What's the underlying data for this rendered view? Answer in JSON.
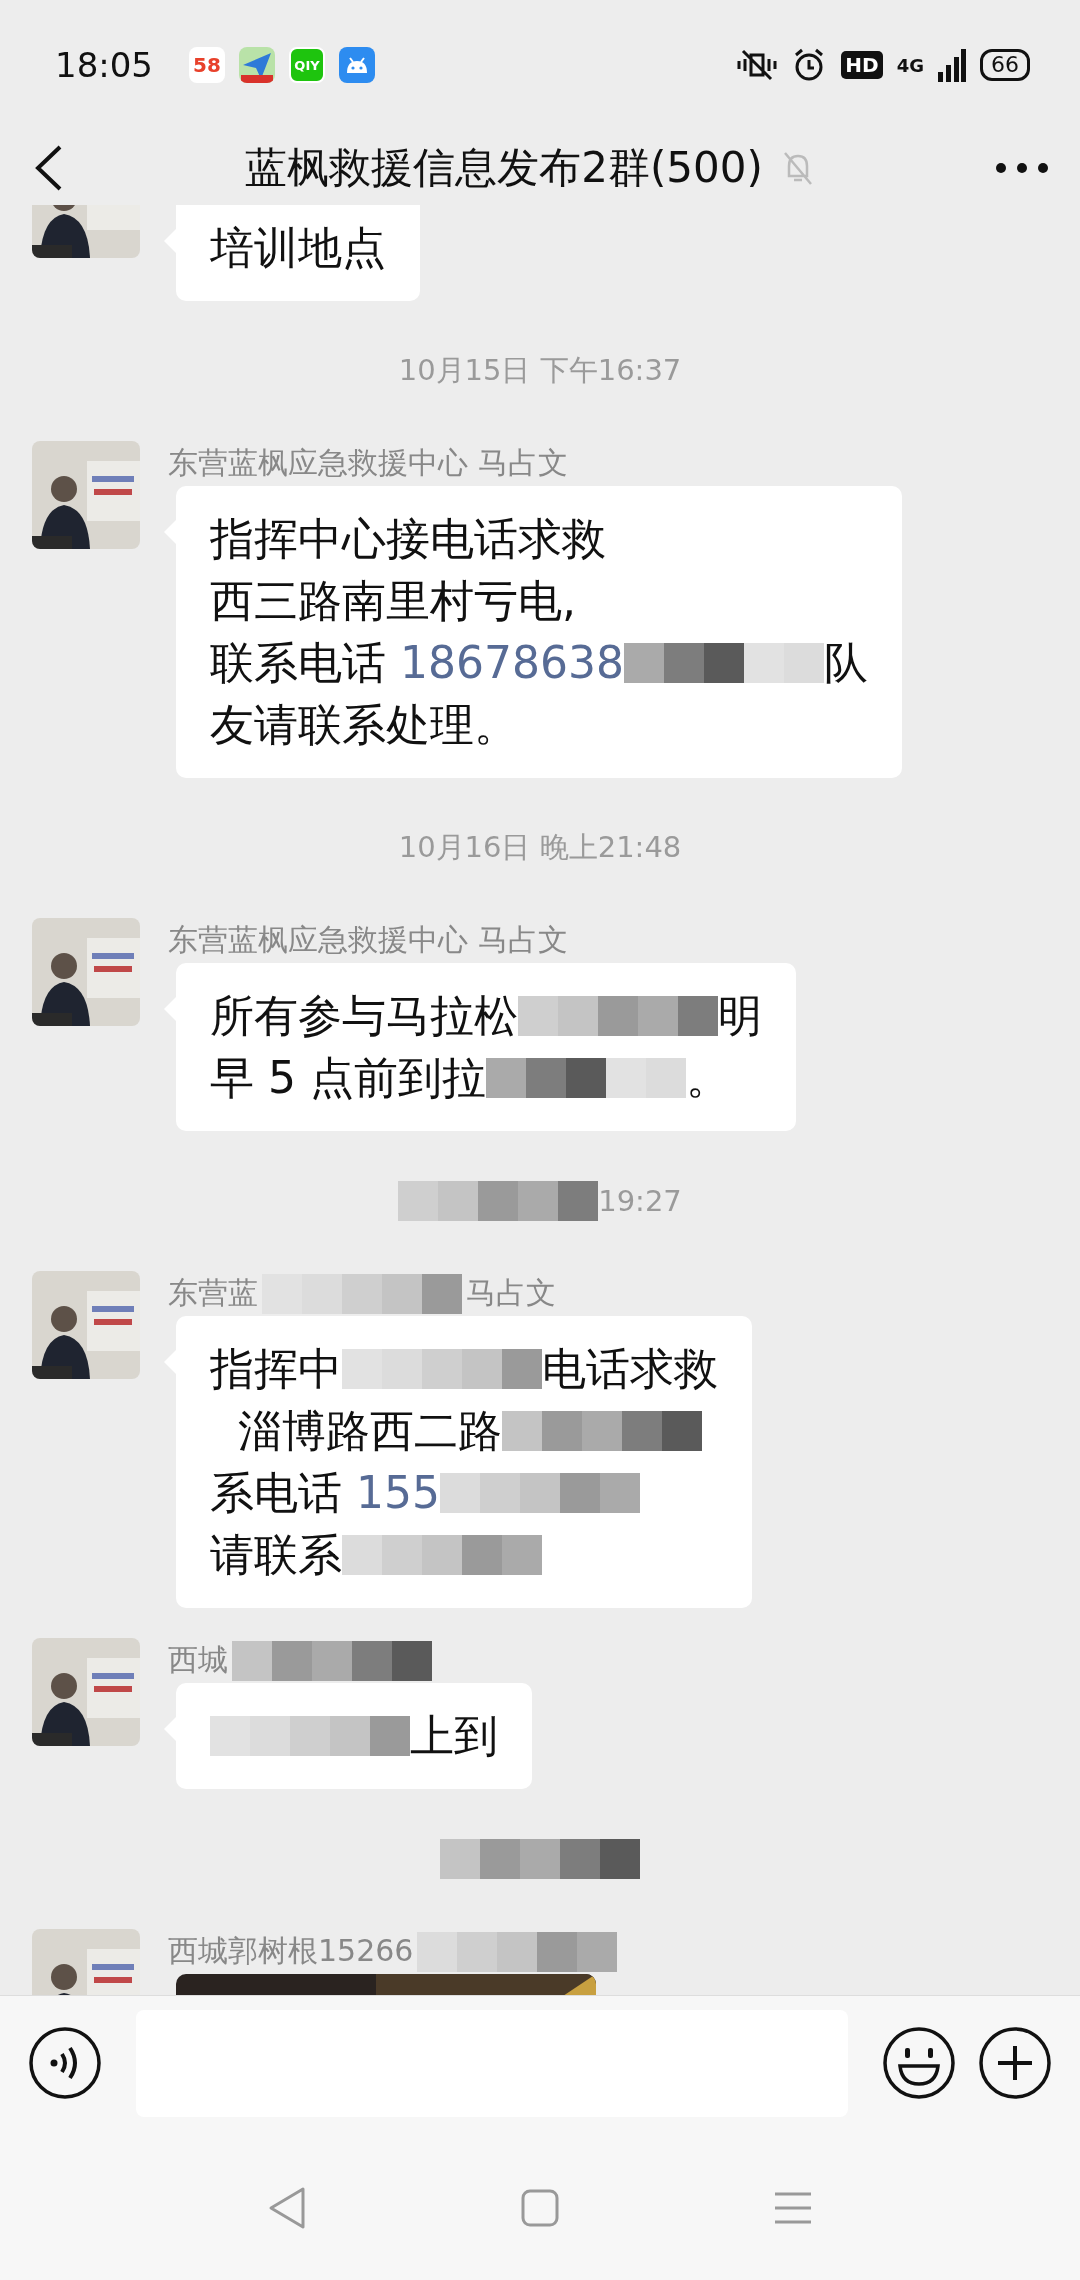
{
  "status_bar": {
    "time": "18:05",
    "app_icons": [
      {
        "kind": "number",
        "text": "58"
      },
      {
        "kind": "plane"
      },
      {
        "kind": "video",
        "text": "QIY"
      },
      {
        "kind": "android"
      }
    ],
    "hd": "HD",
    "network": "4G",
    "battery": "66"
  },
  "header": {
    "title": "蓝枫救援信息发布2群(500)",
    "muted": true
  },
  "messages": [
    {
      "kind": "message",
      "avatar": {
        "kind": "picture"
      },
      "lines": [
        [
          {
            "kind": "text",
            "text": "培训地点"
          }
        ]
      ]
    },
    {
      "kind": "time",
      "parts": [
        {
          "kind": "text",
          "text": "10月15日 下午16:37"
        }
      ]
    },
    {
      "kind": "message",
      "avatar": {
        "kind": "picture"
      },
      "name": [
        {
          "kind": "text",
          "text": "东营蓝枫应急救援中心 马占文"
        }
      ],
      "lines": [
        [
          {
            "kind": "text",
            "text": "指挥中心接电话求救"
          }
        ],
        [
          {
            "kind": "text",
            "text": "西三路南里村亏电,"
          }
        ],
        [
          {
            "kind": "text",
            "text": "联系电话 "
          },
          {
            "kind": "phone",
            "text": "18678638"
          },
          {
            "kind": "mosaic"
          },
          {
            "kind": "text",
            "text": "队"
          }
        ],
        [
          {
            "kind": "text",
            "text": "友请联系处理。"
          }
        ]
      ]
    },
    {
      "kind": "time",
      "parts": [
        {
          "kind": "text",
          "text": "10月16日 晚上21:48"
        }
      ]
    },
    {
      "kind": "message",
      "avatar": {
        "kind": "picture"
      },
      "name": [
        {
          "kind": "text",
          "text": "东营蓝枫应急救援中心 马占文"
        }
      ],
      "lines": [
        [
          {
            "kind": "text",
            "text": "所有参与马拉松"
          },
          {
            "kind": "mosaic"
          },
          {
            "kind": "text",
            "text": "明"
          }
        ],
        [
          {
            "kind": "text",
            "text": "早 5 点前到拉"
          },
          {
            "kind": "mosaic"
          },
          {
            "kind": "text",
            "text": "。"
          }
        ]
      ]
    },
    {
      "kind": "time",
      "parts": [
        {
          "kind": "mosaic"
        },
        {
          "kind": "text",
          "text": "19:27"
        }
      ]
    },
    {
      "kind": "message",
      "avatar": {
        "kind": "picture"
      },
      "name": [
        {
          "kind": "text",
          "text": "东营蓝"
        },
        {
          "kind": "mosaic"
        },
        {
          "kind": "text",
          "text": "马占文"
        }
      ],
      "lines": [
        [
          {
            "kind": "text",
            "text": "指挥中"
          },
          {
            "kind": "mosaic"
          },
          {
            "kind": "text",
            "text": "电话求救"
          }
        ],
        [
          {
            "kind": "text",
            "text": "  淄博路西二路"
          },
          {
            "kind": "mosaic"
          }
        ],
        [
          {
            "kind": "text",
            "text": "系电话 "
          },
          {
            "kind": "phone",
            "text": "155"
          },
          {
            "kind": "mosaic"
          }
        ],
        [
          {
            "kind": "text",
            "text": "请联系"
          },
          {
            "kind": "mosaic"
          }
        ]
      ]
    },
    {
      "kind": "message",
      "avatar": {
        "kind": "picture"
      },
      "name": [
        {
          "kind": "text",
          "text": "西城"
        },
        {
          "kind": "mosaic"
        }
      ],
      "lines": [
        [
          {
            "kind": "mosaic"
          },
          {
            "kind": "text",
            "text": "上到"
          }
        ]
      ]
    },
    {
      "kind": "time",
      "parts": [
        {
          "kind": "mosaic"
        }
      ]
    },
    {
      "kind": "message",
      "avatar": {
        "kind": "picture"
      },
      "name": [
        {
          "kind": "text",
          "text": "西城郭树根15266"
        },
        {
          "kind": "mosaic"
        }
      ],
      "image": {
        "kind": "picture"
      }
    }
  ],
  "nav_bar": [
    {
      "kind": "back"
    },
    {
      "kind": "home"
    },
    {
      "kind": "menu"
    }
  ]
}
